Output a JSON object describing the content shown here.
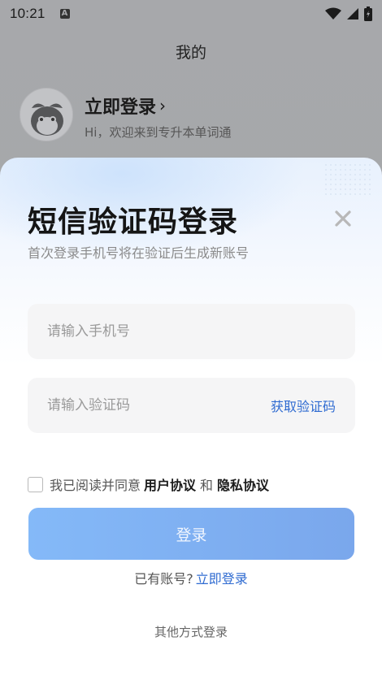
{
  "status_bar": {
    "time": "10:21",
    "notification_badge": "A",
    "icons": [
      "wifi-icon",
      "signal-icon",
      "battery-icon"
    ]
  },
  "background_page": {
    "title": "我的",
    "login_link": "立即登录",
    "welcome": "Hi，欢迎来到专升本单词通"
  },
  "sheet": {
    "title": "短信验证码登录",
    "subtitle": "首次登录手机号将在验证后生成新账号",
    "phone_placeholder": "请输入手机号",
    "code_placeholder": "请输入验证码",
    "get_code_label": "获取验证码",
    "agreement": {
      "prefix": "我已阅读并同意",
      "user_agreement": "用户协议",
      "and": "和",
      "privacy_agreement": "隐私协议",
      "checked": false
    },
    "submit_label": "登录",
    "has_account_text": "已有账号?",
    "login_now_link": "立即登录",
    "other_login": "其他方式登录"
  },
  "colors": {
    "accent": "#2f6bd1",
    "button_start": "#84b9f8",
    "button_end": "#7aa7ec"
  }
}
